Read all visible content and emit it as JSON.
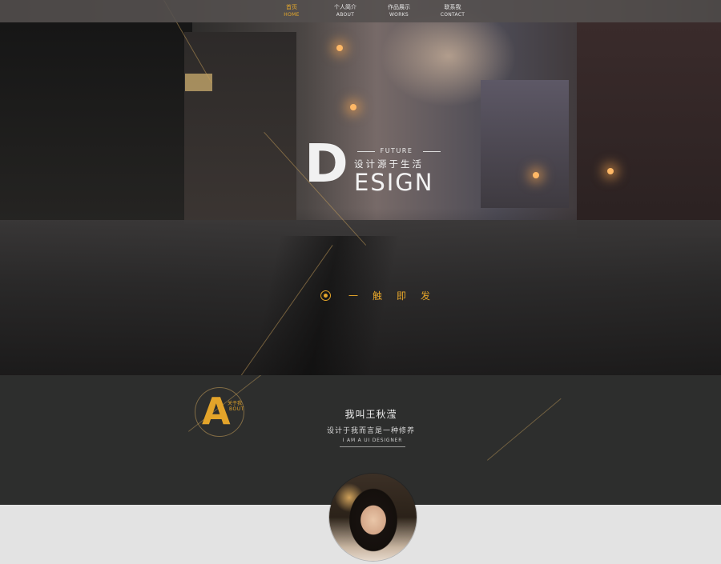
{
  "nav": [
    {
      "zh": "首页",
      "en": "HOME",
      "active": true
    },
    {
      "zh": "个人简介",
      "en": "ABOUT",
      "active": false
    },
    {
      "zh": "作品展示",
      "en": "WORKS",
      "active": false
    },
    {
      "zh": "联系我",
      "en": "CONTACT",
      "active": false
    }
  ],
  "hero": {
    "logo_letter": "D",
    "future": "FUTURE",
    "slogan": "设计源于生活",
    "design_rest": "ESIGN",
    "trigger_label": "一触即发"
  },
  "about": {
    "badge_letter": "A",
    "badge_zh": "关于我",
    "badge_en": "BOUT",
    "name": "我叫王秋滢",
    "motto": "设计于我而言是一种修养",
    "role": "I AM A UI DESIGNER"
  },
  "colors": {
    "accent": "#e3a42a",
    "about_bg": "#2d2e2d",
    "footer_bg": "#e3e3e3"
  }
}
